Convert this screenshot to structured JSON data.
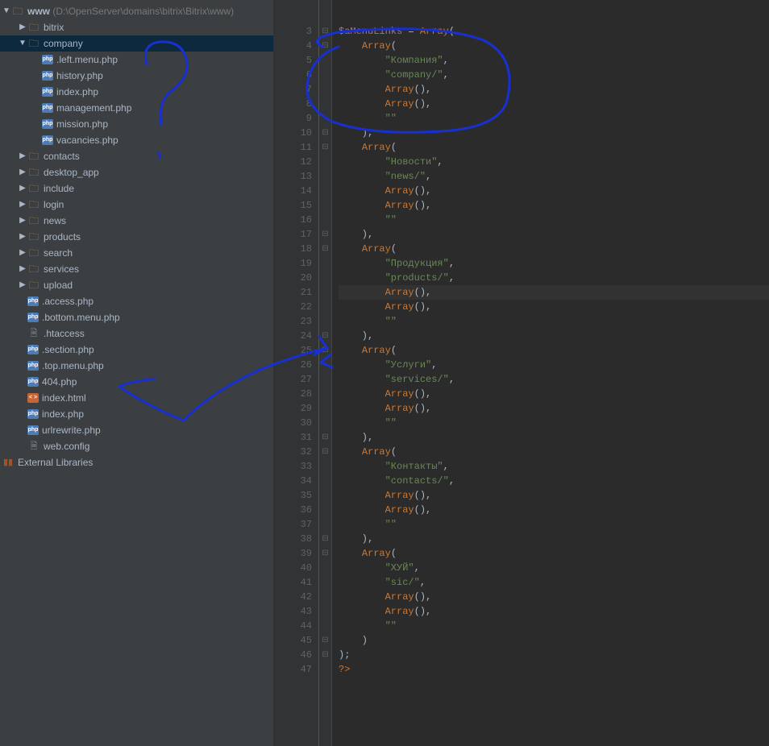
{
  "project": {
    "root_name": "www",
    "root_path": "(D:\\OpenServer\\domains\\bitrix\\Bitrix\\www)",
    "tree": [
      {
        "indent": 1,
        "arrow": "right",
        "icon": "folder",
        "label": "bitrix"
      },
      {
        "indent": 1,
        "arrow": "down",
        "icon": "folder",
        "label": "company",
        "selected": true
      },
      {
        "indent": 2,
        "arrow": "",
        "icon": "php",
        "label": ".left.menu.php"
      },
      {
        "indent": 2,
        "arrow": "",
        "icon": "php",
        "label": "history.php"
      },
      {
        "indent": 2,
        "arrow": "",
        "icon": "php",
        "label": "index.php"
      },
      {
        "indent": 2,
        "arrow": "",
        "icon": "php",
        "label": "management.php"
      },
      {
        "indent": 2,
        "arrow": "",
        "icon": "php",
        "label": "mission.php"
      },
      {
        "indent": 2,
        "arrow": "",
        "icon": "php",
        "label": "vacancies.php"
      },
      {
        "indent": 1,
        "arrow": "right",
        "icon": "folder",
        "label": "contacts"
      },
      {
        "indent": 1,
        "arrow": "right",
        "icon": "folder",
        "label": "desktop_app"
      },
      {
        "indent": 1,
        "arrow": "right",
        "icon": "folder",
        "label": "include"
      },
      {
        "indent": 1,
        "arrow": "right",
        "icon": "folder",
        "label": "login"
      },
      {
        "indent": 1,
        "arrow": "right",
        "icon": "folder",
        "label": "news"
      },
      {
        "indent": 1,
        "arrow": "right",
        "icon": "folder",
        "label": "products"
      },
      {
        "indent": 1,
        "arrow": "right",
        "icon": "folder",
        "label": "search"
      },
      {
        "indent": 1,
        "arrow": "right",
        "icon": "folder",
        "label": "services"
      },
      {
        "indent": 1,
        "arrow": "right",
        "icon": "folder",
        "label": "upload"
      },
      {
        "indent": 1,
        "arrow": "",
        "icon": "php",
        "label": ".access.php"
      },
      {
        "indent": 1,
        "arrow": "",
        "icon": "php",
        "label": ".bottom.menu.php"
      },
      {
        "indent": 1,
        "arrow": "",
        "icon": "file",
        "label": ".htaccess"
      },
      {
        "indent": 1,
        "arrow": "",
        "icon": "php",
        "label": ".section.php"
      },
      {
        "indent": 1,
        "arrow": "",
        "icon": "php",
        "label": ".top.menu.php"
      },
      {
        "indent": 1,
        "arrow": "",
        "icon": "php",
        "label": "404.php"
      },
      {
        "indent": 1,
        "arrow": "",
        "icon": "html",
        "label": "index.html"
      },
      {
        "indent": 1,
        "arrow": "",
        "icon": "php",
        "label": "index.php"
      },
      {
        "indent": 1,
        "arrow": "",
        "icon": "php",
        "label": "urlrewrite.php"
      },
      {
        "indent": 1,
        "arrow": "",
        "icon": "file",
        "label": "web.config"
      }
    ],
    "external_libs": "External Libraries"
  },
  "code": {
    "lines": [
      {
        "n": 3,
        "fold": "⊟",
        "html": "<span class='var'>$aMenuLinks</span> = <span class='kw'>Array</span>("
      },
      {
        "n": 4,
        "fold": "⊟",
        "html": "    <span class='kw'>Array</span>("
      },
      {
        "n": 5,
        "fold": "",
        "html": "        <span class='str'>\"Компания\"</span>,"
      },
      {
        "n": 6,
        "fold": "",
        "html": "        <span class='str'>\"company/\"</span>,"
      },
      {
        "n": 7,
        "fold": "",
        "html": "        <span class='kw'>Array</span>(),"
      },
      {
        "n": 8,
        "fold": "",
        "html": "        <span class='kw'>Array</span>(),"
      },
      {
        "n": 9,
        "fold": "",
        "html": "        <span class='str'>\"\"</span>"
      },
      {
        "n": 10,
        "fold": "⊟",
        "html": "    ),"
      },
      {
        "n": 11,
        "fold": "⊟",
        "html": "    <span class='kw'>Array</span>("
      },
      {
        "n": 12,
        "fold": "",
        "html": "        <span class='str'>\"Новости\"</span>,"
      },
      {
        "n": 13,
        "fold": "",
        "html": "        <span class='str'>\"news/\"</span>,"
      },
      {
        "n": 14,
        "fold": "",
        "html": "        <span class='kw'>Array</span>(),"
      },
      {
        "n": 15,
        "fold": "",
        "html": "        <span class='kw'>Array</span>(),"
      },
      {
        "n": 16,
        "fold": "",
        "html": "        <span class='str'>\"\"</span>"
      },
      {
        "n": 17,
        "fold": "⊟",
        "html": "    ),"
      },
      {
        "n": 18,
        "fold": "⊟",
        "html": "    <span class='kw'>Array</span>("
      },
      {
        "n": 19,
        "fold": "",
        "html": "        <span class='str'>\"Продукция\"</span>,"
      },
      {
        "n": 20,
        "fold": "",
        "html": "        <span class='str'>\"products/\"</span>,"
      },
      {
        "n": 21,
        "fold": "",
        "hl": true,
        "html": "        <span class='kw'>Array</span>(),"
      },
      {
        "n": 22,
        "fold": "",
        "html": "        <span class='kw'>Array</span>(),"
      },
      {
        "n": 23,
        "fold": "",
        "html": "        <span class='str'>\"\"</span>"
      },
      {
        "n": 24,
        "fold": "⊟",
        "html": "    ),"
      },
      {
        "n": 25,
        "fold": "⊟",
        "html": "    <span class='kw'>Array</span>("
      },
      {
        "n": 26,
        "fold": "",
        "html": "        <span class='str'>\"Услуги\"</span>,"
      },
      {
        "n": 27,
        "fold": "",
        "html": "        <span class='str'>\"services/\"</span>,"
      },
      {
        "n": 28,
        "fold": "",
        "html": "        <span class='kw'>Array</span>(),"
      },
      {
        "n": 29,
        "fold": "",
        "html": "        <span class='kw'>Array</span>(),"
      },
      {
        "n": 30,
        "fold": "",
        "html": "        <span class='str'>\"\"</span>"
      },
      {
        "n": 31,
        "fold": "⊟",
        "html": "    ),"
      },
      {
        "n": 32,
        "fold": "⊟",
        "html": "    <span class='kw'>Array</span>("
      },
      {
        "n": 33,
        "fold": "",
        "html": "        <span class='str'>\"Контакты\"</span>,"
      },
      {
        "n": 34,
        "fold": "",
        "html": "        <span class='str'>\"contacts/\"</span>,"
      },
      {
        "n": 35,
        "fold": "",
        "html": "        <span class='kw'>Array</span>(),"
      },
      {
        "n": 36,
        "fold": "",
        "html": "        <span class='kw'>Array</span>(),"
      },
      {
        "n": 37,
        "fold": "",
        "html": "        <span class='str'>\"\"</span>"
      },
      {
        "n": 38,
        "fold": "⊟",
        "html": "    ),"
      },
      {
        "n": 39,
        "fold": "⊟",
        "html": "    <span class='kw'>Array</span>("
      },
      {
        "n": 40,
        "fold": "",
        "html": "        <span class='str'>\"ХУЙ\"</span>,"
      },
      {
        "n": 41,
        "fold": "",
        "html": "        <span class='str'>\"sic/\"</span>,"
      },
      {
        "n": 42,
        "fold": "",
        "html": "        <span class='kw'>Array</span>(),"
      },
      {
        "n": 43,
        "fold": "",
        "html": "        <span class='kw'>Array</span>(),"
      },
      {
        "n": 44,
        "fold": "",
        "html": "        <span class='str'>\"\"</span>"
      },
      {
        "n": 45,
        "fold": "⊟",
        "html": "    )"
      },
      {
        "n": 46,
        "fold": "⊟",
        "html": ");"
      },
      {
        "n": 47,
        "fold": "",
        "html": "<span class='tag'>?&gt;</span>"
      }
    ]
  }
}
